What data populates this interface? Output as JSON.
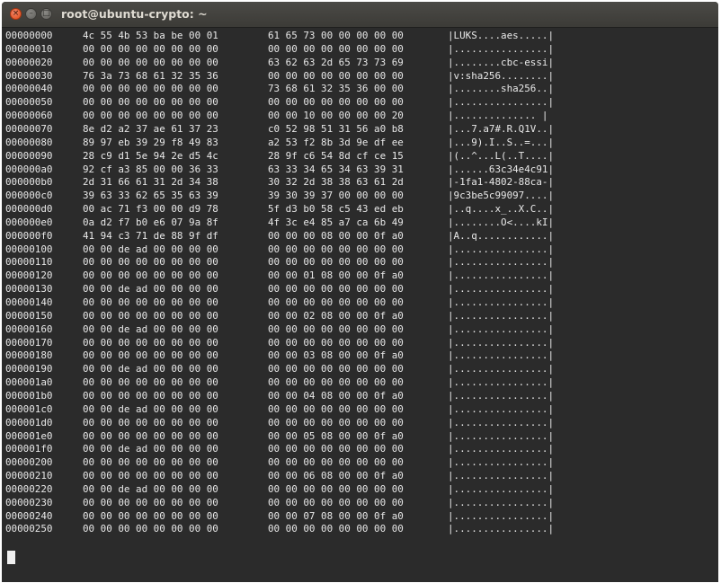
{
  "window": {
    "title": "root@ubuntu-crypto: ~",
    "buttons": {
      "close_glyph": "×",
      "minimize_glyph": "–",
      "maximize_glyph": "□"
    }
  },
  "colors": {
    "terminal_bg": "#2b2b2b",
    "terminal_fg": "#e8e8e8",
    "close_button": "#df4a16",
    "titlebar": "#3c3b37"
  },
  "hexdump": [
    {
      "offset": "00000000",
      "hex1": "4c 55 4b 53 ba be 00 01",
      "hex2": "61 65 73 00 00 00 00 00",
      "ascii": "|LUKS....aes.....|"
    },
    {
      "offset": "00000010",
      "hex1": "00 00 00 00 00 00 00 00",
      "hex2": "00 00 00 00 00 00 00 00",
      "ascii": "|................|"
    },
    {
      "offset": "00000020",
      "hex1": "00 00 00 00 00 00 00 00",
      "hex2": "63 62 63 2d 65 73 73 69",
      "ascii": "|........cbc-essi|"
    },
    {
      "offset": "00000030",
      "hex1": "76 3a 73 68 61 32 35 36",
      "hex2": "00 00 00 00 00 00 00 00",
      "ascii": "|v:sha256........|"
    },
    {
      "offset": "00000040",
      "hex1": "00 00 00 00 00 00 00 00",
      "hex2": "73 68 61 32 35 36 00 00",
      "ascii": "|........sha256..|"
    },
    {
      "offset": "00000050",
      "hex1": "00 00 00 00 00 00 00 00",
      "hex2": "00 00 00 00 00 00 00 00",
      "ascii": "|................|"
    },
    {
      "offset": "00000060",
      "hex1": "00 00 00 00 00 00 00 00",
      "hex2": "00 00 10 00 00 00 00 20",
      "ascii": "|.............. |"
    },
    {
      "offset": "00000070",
      "hex1": "8e d2 a2 37 ae 61 37 23",
      "hex2": "c0 52 98 51 31 56 a0 b8",
      "ascii": "|...7.a7#.R.Q1V..|"
    },
    {
      "offset": "00000080",
      "hex1": "89 97 eb 39 29 f8 49 83",
      "hex2": "a2 53 f2 8b 3d 9e df ee",
      "ascii": "|...9).I..S..=...|"
    },
    {
      "offset": "00000090",
      "hex1": "28 c9 d1 5e 94 2e d5 4c",
      "hex2": "28 9f c6 54 8d cf ce 15",
      "ascii": "|(..^...L(..T....|"
    },
    {
      "offset": "000000a0",
      "hex1": "92 cf a3 85 00 00 36 33",
      "hex2": "63 33 34 65 34 63 39 31",
      "ascii": "|......63c34e4c91|"
    },
    {
      "offset": "000000b0",
      "hex1": "2d 31 66 61 31 2d 34 38",
      "hex2": "30 32 2d 38 38 63 61 2d",
      "ascii": "|-1fa1-4802-88ca-|"
    },
    {
      "offset": "000000c0",
      "hex1": "39 63 33 62 65 35 63 39",
      "hex2": "39 30 39 37 00 00 00 00",
      "ascii": "|9c3be5c99097....|"
    },
    {
      "offset": "000000d0",
      "hex1": "00 ac 71 f3 00 00 d9 78",
      "hex2": "5f d3 b0 58 c5 43 ed eb",
      "ascii": "|..q....x_..X.C..|"
    },
    {
      "offset": "000000e0",
      "hex1": "0a d2 f7 b0 e6 07 9a 8f",
      "hex2": "4f 3c e4 85 a7 ca 6b 49",
      "ascii": "|........O<....kI|"
    },
    {
      "offset": "000000f0",
      "hex1": "41 94 c3 71 de 88 9f df",
      "hex2": "00 00 00 08 00 00 0f a0",
      "ascii": "|A..q............|"
    },
    {
      "offset": "00000100",
      "hex1": "00 00 de ad 00 00 00 00",
      "hex2": "00 00 00 00 00 00 00 00",
      "ascii": "|................|"
    },
    {
      "offset": "00000110",
      "hex1": "00 00 00 00 00 00 00 00",
      "hex2": "00 00 00 00 00 00 00 00",
      "ascii": "|................|"
    },
    {
      "offset": "00000120",
      "hex1": "00 00 00 00 00 00 00 00",
      "hex2": "00 00 01 08 00 00 0f a0",
      "ascii": "|................|"
    },
    {
      "offset": "00000130",
      "hex1": "00 00 de ad 00 00 00 00",
      "hex2": "00 00 00 00 00 00 00 00",
      "ascii": "|................|"
    },
    {
      "offset": "00000140",
      "hex1": "00 00 00 00 00 00 00 00",
      "hex2": "00 00 00 00 00 00 00 00",
      "ascii": "|................|"
    },
    {
      "offset": "00000150",
      "hex1": "00 00 00 00 00 00 00 00",
      "hex2": "00 00 02 08 00 00 0f a0",
      "ascii": "|................|"
    },
    {
      "offset": "00000160",
      "hex1": "00 00 de ad 00 00 00 00",
      "hex2": "00 00 00 00 00 00 00 00",
      "ascii": "|................|"
    },
    {
      "offset": "00000170",
      "hex1": "00 00 00 00 00 00 00 00",
      "hex2": "00 00 00 00 00 00 00 00",
      "ascii": "|................|"
    },
    {
      "offset": "00000180",
      "hex1": "00 00 00 00 00 00 00 00",
      "hex2": "00 00 03 08 00 00 0f a0",
      "ascii": "|................|"
    },
    {
      "offset": "00000190",
      "hex1": "00 00 de ad 00 00 00 00",
      "hex2": "00 00 00 00 00 00 00 00",
      "ascii": "|................|"
    },
    {
      "offset": "000001a0",
      "hex1": "00 00 00 00 00 00 00 00",
      "hex2": "00 00 00 00 00 00 00 00",
      "ascii": "|................|"
    },
    {
      "offset": "000001b0",
      "hex1": "00 00 00 00 00 00 00 00",
      "hex2": "00 00 04 08 00 00 0f a0",
      "ascii": "|................|"
    },
    {
      "offset": "000001c0",
      "hex1": "00 00 de ad 00 00 00 00",
      "hex2": "00 00 00 00 00 00 00 00",
      "ascii": "|................|"
    },
    {
      "offset": "000001d0",
      "hex1": "00 00 00 00 00 00 00 00",
      "hex2": "00 00 00 00 00 00 00 00",
      "ascii": "|................|"
    },
    {
      "offset": "000001e0",
      "hex1": "00 00 00 00 00 00 00 00",
      "hex2": "00 00 05 08 00 00 0f a0",
      "ascii": "|................|"
    },
    {
      "offset": "000001f0",
      "hex1": "00 00 de ad 00 00 00 00",
      "hex2": "00 00 00 00 00 00 00 00",
      "ascii": "|................|"
    },
    {
      "offset": "00000200",
      "hex1": "00 00 00 00 00 00 00 00",
      "hex2": "00 00 00 00 00 00 00 00",
      "ascii": "|................|"
    },
    {
      "offset": "00000210",
      "hex1": "00 00 00 00 00 00 00 00",
      "hex2": "00 00 06 08 00 00 0f a0",
      "ascii": "|................|"
    },
    {
      "offset": "00000220",
      "hex1": "00 00 de ad 00 00 00 00",
      "hex2": "00 00 00 00 00 00 00 00",
      "ascii": "|................|"
    },
    {
      "offset": "00000230",
      "hex1": "00 00 00 00 00 00 00 00",
      "hex2": "00 00 00 00 00 00 00 00",
      "ascii": "|................|"
    },
    {
      "offset": "00000240",
      "hex1": "00 00 00 00 00 00 00 00",
      "hex2": "00 00 07 08 00 00 0f a0",
      "ascii": "|................|"
    },
    {
      "offset": "00000250",
      "hex1": "00 00 00 00 00 00 00 00",
      "hex2": "00 00 00 00 00 00 00 00",
      "ascii": "|................|"
    }
  ]
}
